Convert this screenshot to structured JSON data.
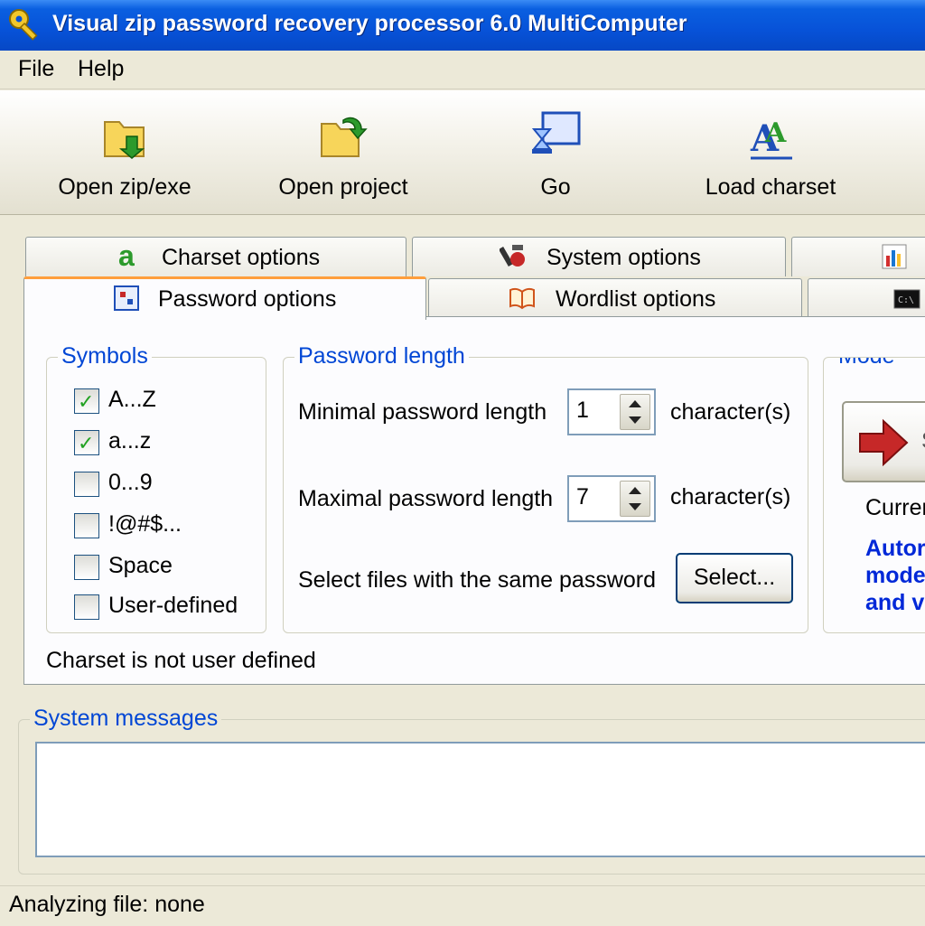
{
  "window": {
    "title": "Visual zip password recovery processor 6.0 MultiComputer"
  },
  "menu": {
    "file": "File",
    "help": "Help"
  },
  "toolbar": {
    "open_zip": "Open zip/exe",
    "open_project": "Open project",
    "go": "Go",
    "load_charset": "Load charset"
  },
  "tabs": {
    "charset": "Charset options",
    "system": "System options",
    "password": "Password options",
    "wordlist": "Wordlist options"
  },
  "symbols": {
    "title": "Symbols",
    "items": [
      {
        "label": "A...Z",
        "checked": true
      },
      {
        "label": "a...z",
        "checked": true
      },
      {
        "label": "0...9",
        "checked": false
      },
      {
        "label": "!@#$...",
        "checked": false
      },
      {
        "label": "Space",
        "checked": false
      },
      {
        "label": "User-defined",
        "checked": false
      }
    ]
  },
  "password_length": {
    "title": "Password length",
    "min_label": "Minimal password length",
    "min_value": "1",
    "max_label": "Maximal password length",
    "max_value": "7",
    "unit": "character(s)",
    "select_files_label": "Select files with the same password",
    "select_button": "Select..."
  },
  "mode": {
    "title": "Mode",
    "current_prefix": "Curren",
    "auto_lines": [
      "Autor",
      "mode",
      "and v"
    ]
  },
  "charset_status": "Charset is not user defined",
  "system_messages": {
    "title": "System messages"
  },
  "status": {
    "analyzing": "Analyzing file: none"
  },
  "colors": {
    "titlebar": "#0752d8",
    "group_title": "#0046d5",
    "tab_highlight": "#ff9e3c",
    "check": "#21a121"
  }
}
